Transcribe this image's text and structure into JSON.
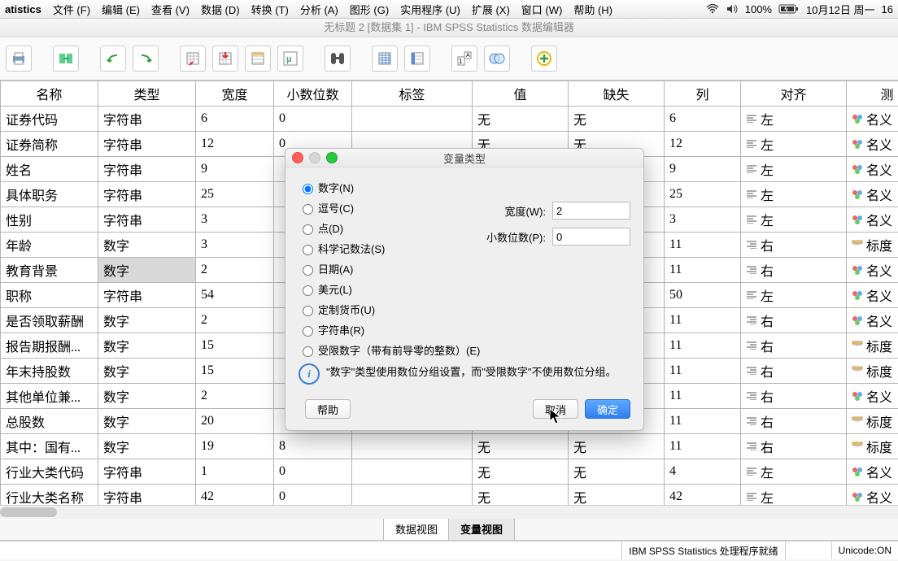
{
  "menubar": {
    "app": "atistics",
    "items": [
      "文件 (F)",
      "编辑 (E)",
      "查看 (V)",
      "数据 (D)",
      "转换 (T)",
      "分析 (A)",
      "图形 (G)",
      "实用程序 (U)",
      "扩展 (X)",
      "窗口 (W)",
      "帮助 (H)"
    ],
    "battery": "100%",
    "date": "10月12日 周一",
    "clock": "16"
  },
  "window_title": "无标题 2 [数据集 1] - IBM SPSS Statistics 数据编辑器",
  "columns": [
    "名称",
    "类型",
    "宽度",
    "小数位数",
    "标签",
    "值",
    "缺失",
    "列",
    "对齐",
    "测"
  ],
  "rows": [
    {
      "name": "证券代码",
      "type": "字符串",
      "width": "6",
      "dec": "0",
      "label": "",
      "val": "无",
      "miss": "无",
      "col": "6",
      "align": "左",
      "meas": "名义"
    },
    {
      "name": "证券简称",
      "type": "字符串",
      "width": "12",
      "dec": "0",
      "label": "",
      "val": "无",
      "miss": "无",
      "col": "12",
      "align": "左",
      "meas": "名义"
    },
    {
      "name": "姓名",
      "type": "字符串",
      "width": "9",
      "dec": "",
      "label": "",
      "val": "",
      "miss": "",
      "col": "9",
      "align": "左",
      "meas": "名义"
    },
    {
      "name": "具体职务",
      "type": "字符串",
      "width": "25",
      "dec": "",
      "label": "",
      "val": "",
      "miss": "",
      "col": "25",
      "align": "左",
      "meas": "名义"
    },
    {
      "name": "性别",
      "type": "字符串",
      "width": "3",
      "dec": "",
      "label": "",
      "val": "",
      "miss": "",
      "col": "3",
      "align": "左",
      "meas": "名义"
    },
    {
      "name": "年龄",
      "type": "数字",
      "width": "3",
      "dec": "",
      "label": "",
      "val": "",
      "miss": "",
      "col": "11",
      "align": "右",
      "meas": "标度"
    },
    {
      "name": "教育背景",
      "type": "数字",
      "width": "2",
      "dec": "",
      "label": "",
      "val": "",
      "miss": "",
      "col": "11",
      "align": "右",
      "meas": "名义",
      "sel": true
    },
    {
      "name": "职称",
      "type": "字符串",
      "width": "54",
      "dec": "",
      "label": "",
      "val": "",
      "miss": "",
      "col": "50",
      "align": "左",
      "meas": "名义"
    },
    {
      "name": "是否领取薪酬",
      "type": "数字",
      "width": "2",
      "dec": "",
      "label": "",
      "val": "",
      "miss": "",
      "col": "11",
      "align": "右",
      "meas": "名义"
    },
    {
      "name": "报告期报酬...",
      "type": "数字",
      "width": "15",
      "dec": "",
      "label": "",
      "val": "",
      "miss": "",
      "col": "11",
      "align": "右",
      "meas": "标度"
    },
    {
      "name": "年末持股数",
      "type": "数字",
      "width": "15",
      "dec": "",
      "label": "",
      "val": "",
      "miss": "",
      "col": "11",
      "align": "右",
      "meas": "标度"
    },
    {
      "name": "其他单位兼...",
      "type": "数字",
      "width": "2",
      "dec": "",
      "label": "",
      "val": "",
      "miss": "",
      "col": "11",
      "align": "右",
      "meas": "名义"
    },
    {
      "name": "总股数",
      "type": "数字",
      "width": "20",
      "dec": "",
      "label": "",
      "val": "",
      "miss": "",
      "col": "11",
      "align": "右",
      "meas": "标度"
    },
    {
      "name": "其中：国有...",
      "type": "数字",
      "width": "19",
      "dec": "8",
      "label": "",
      "val": "无",
      "miss": "无",
      "col": "11",
      "align": "右",
      "meas": "标度"
    },
    {
      "name": "行业大类代码",
      "type": "字符串",
      "width": "1",
      "dec": "0",
      "label": "",
      "val": "无",
      "miss": "无",
      "col": "4",
      "align": "左",
      "meas": "名义"
    },
    {
      "name": "行业大类名称",
      "type": "字符串",
      "width": "42",
      "dec": "0",
      "label": "",
      "val": "无",
      "miss": "无",
      "col": "42",
      "align": "左",
      "meas": "名义"
    }
  ],
  "tabs": {
    "data": "数据视图",
    "var": "变量视图"
  },
  "status": {
    "proc": "IBM SPSS Statistics 处理程序就绪",
    "unicode": "Unicode:ON"
  },
  "dialog": {
    "title": "变量类型",
    "radios": [
      "数字(N)",
      "逗号(C)",
      "点(D)",
      "科学记数法(S)",
      "日期(A)",
      "美元(L)",
      "定制货币(U)",
      "字符串(R)",
      "受限数字（带有前导零的整数）(E)"
    ],
    "width_label": "宽度(W):",
    "width_value": "2",
    "dec_label": "小数位数(P):",
    "dec_value": "0",
    "info": "\"数字\"类型使用数位分组设置，而\"受限数字\"不使用数位分组。",
    "help": "帮助",
    "cancel": "取消",
    "ok": "确定"
  }
}
